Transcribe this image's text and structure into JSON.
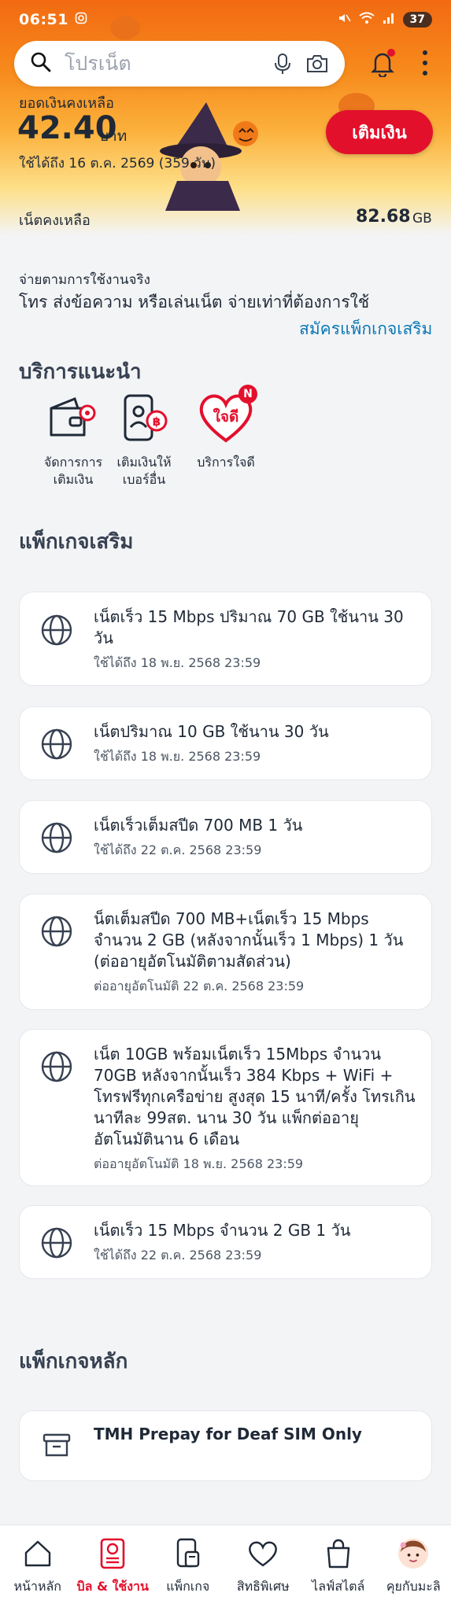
{
  "status": {
    "time": "06:51",
    "battery": "37"
  },
  "search": {
    "placeholder": "โปรเน็ต"
  },
  "balance": {
    "label": "ยอดเงินคงเหลือ",
    "amount": "42.40",
    "unit": "บาท",
    "valid": "ใช้ได้ถึง 16 ต.ค. 2569 (359 วัน)",
    "topup_label": "เติมเงิน"
  },
  "net": {
    "label": "เน็ตคงเหลือ",
    "value": "82.68",
    "unit": "GB"
  },
  "payg": {
    "title": "จ่ายตามการใช้งานจริง",
    "desc": "โทร ส่งข้อความ หรือเล่นเน็ต จ่ายเท่าที่ต้องการใช้",
    "link": "สมัครแพ็กเกจเสริม"
  },
  "services": {
    "title": "บริการแนะนำ",
    "items": [
      {
        "label": "จัดการการ\nเติมเงิน",
        "icon": "wallet-gear-icon"
      },
      {
        "label": "เติมเงินให้\nเบอร์อื่น",
        "icon": "phone-baht-icon"
      },
      {
        "label": "บริการใจดี",
        "icon": "heart-jaidee-icon",
        "badge": "N",
        "logo_text": "ใจดี"
      }
    ]
  },
  "addons": {
    "title": "แพ็กเกจเสริม",
    "items": [
      {
        "title": "เน็ตเร็ว 15 Mbps ปริมาณ 70 GB ใช้นาน 30 วัน",
        "sub": "ใช้ได้ถึง 18 พ.ย. 2568 23:59"
      },
      {
        "title": "เน็ตปริมาณ 10 GB ใช้นาน 30 วัน",
        "sub": "ใช้ได้ถึง 18 พ.ย. 2568 23:59"
      },
      {
        "title": "เน็ตเร็วเต็มสปีด 700 MB 1 วัน",
        "sub": "ใช้ได้ถึง 22 ต.ค. 2568 23:59"
      },
      {
        "title": "น็ตเต็มสปีด 700 MB+เน็ตเร็ว 15 Mbps จำนวน 2 GB (หลังจากนั้นเร็ว 1 Mbps) 1 วัน (ต่ออายุอัตโนมัติตามสัดส่วน)",
        "sub": "ต่ออายุอัตโนมัติ 22 ต.ค. 2568 23:59"
      },
      {
        "title": "เน็ต 10GB พร้อมเน็ตเร็ว 15Mbps จำนวน 70GB หลังจากนั้นเร็ว 384 Kbps + WiFi + โทรฟรีทุกเครือข่าย สูงสุด 15 นาที/ครั้ง โทรเกินนาทีละ 99สต. นาน 30 วัน แพ็กต่ออายุอัตโนมัตินาน 6 เดือน",
        "sub": "ต่ออายุอัตโนมัติ 18 พ.ย. 2568 23:59"
      },
      {
        "title": "เน็ตเร็ว 15 Mbps จำนวน 2 GB 1 วัน",
        "sub": "ใช้ได้ถึง 22 ต.ค. 2568 23:59"
      }
    ]
  },
  "main_package": {
    "title": "แพ็กเกจหลัก",
    "item": {
      "title": "TMH Prepay  for  Deaf SIM Only"
    }
  },
  "nav": {
    "items": [
      {
        "label": "หน้าหลัก",
        "icon": "home-icon"
      },
      {
        "label": "บิล & ใช้งาน",
        "icon": "bill-icon",
        "active": true
      },
      {
        "label": "แพ็กเกจ",
        "icon": "package-icon"
      },
      {
        "label": "สิทธิพิเศษ",
        "icon": "heart-icon"
      },
      {
        "label": "ไลฟ์สไตล์",
        "icon": "shopping-bag-icon"
      },
      {
        "label": "คุยกับมะลิ",
        "icon": "mali-avatar-icon"
      }
    ]
  },
  "colors": {
    "brand_red": "#e3102c",
    "link_blue": "#0a78b5"
  }
}
